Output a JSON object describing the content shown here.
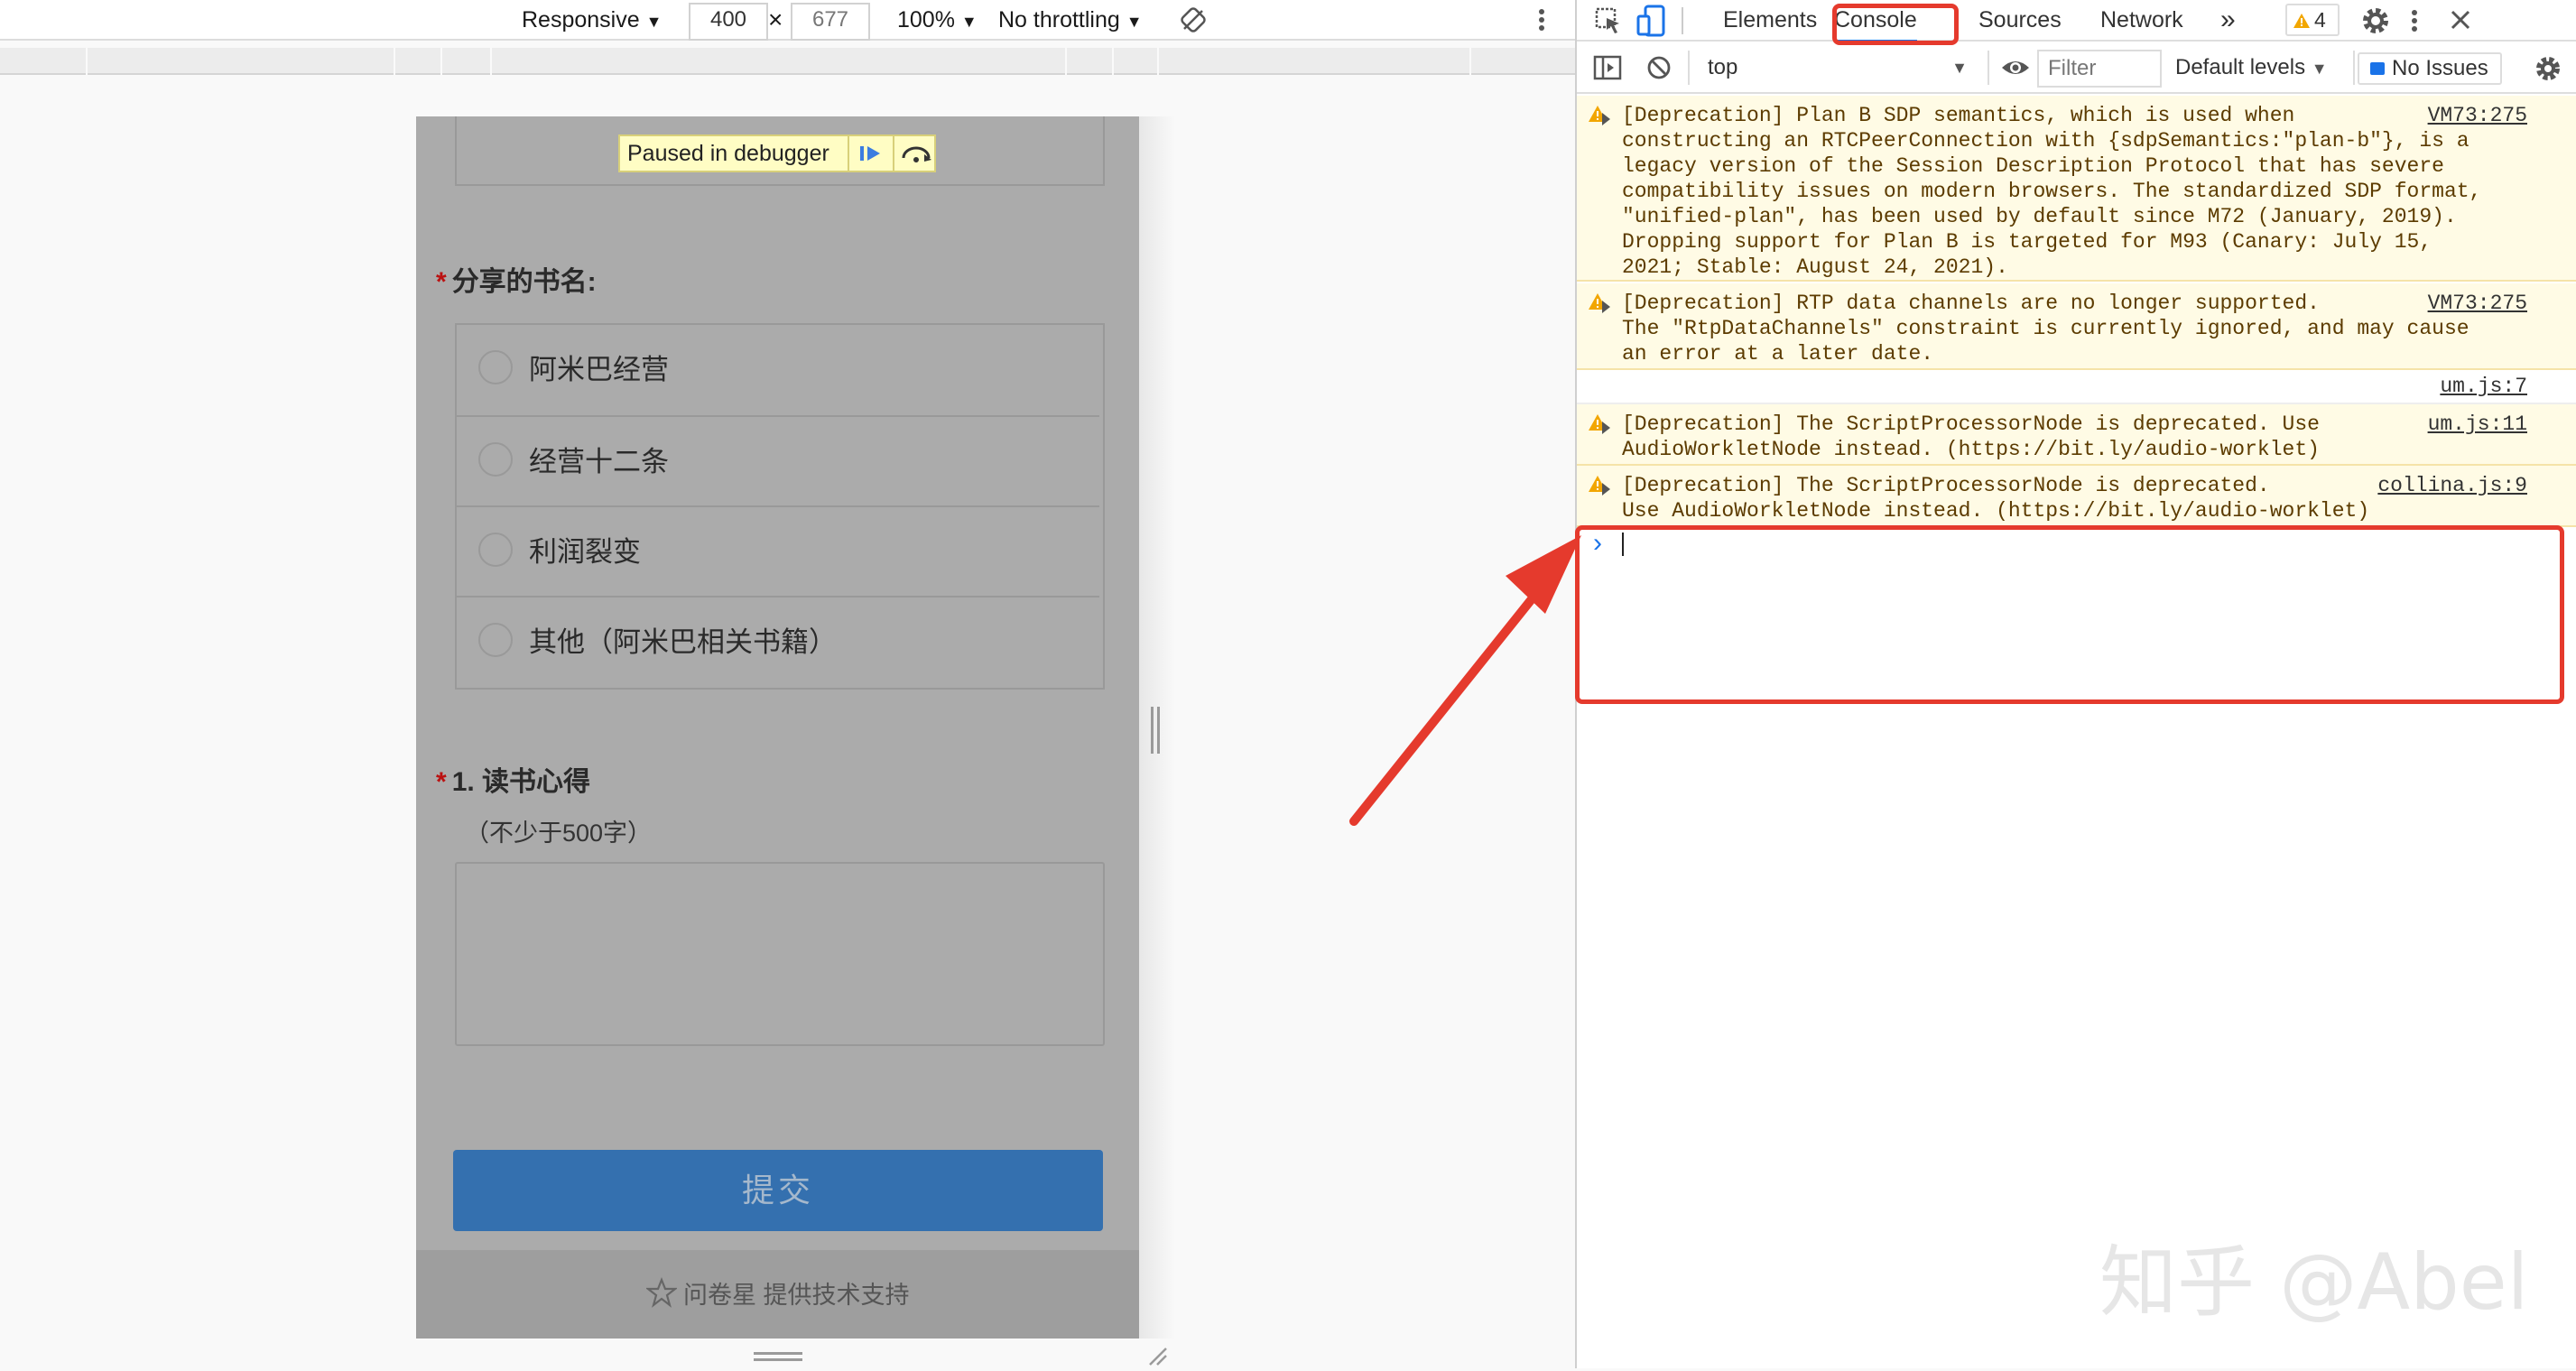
{
  "device_toolbar": {
    "device_mode": "Responsive",
    "width": "400",
    "times": "×",
    "height": "677",
    "zoom": "100%",
    "throttling": "No throttling"
  },
  "page": {
    "paused_label": "Paused in debugger",
    "q1": {
      "required_mark": "*",
      "title": "分享的书名:",
      "options": [
        "阿米巴经营",
        "经营十二条",
        "利润裂变",
        "其他（阿米巴相关书籍）"
      ]
    },
    "q2": {
      "required_mark": "*",
      "title": "1. 读书心得",
      "hint": "（不少于500字）"
    },
    "submit_label": "提交",
    "footer_text": "问卷星 提供技术支持"
  },
  "devtools": {
    "tabs": [
      "Elements",
      "Console",
      "Sources",
      "Network"
    ],
    "active_tab": "Console",
    "more_tabs": "»",
    "warning_count": "4",
    "console_toolbar": {
      "context": "top",
      "filter_placeholder": "Filter",
      "levels": "Default levels",
      "issues": "No Issues"
    },
    "messages": [
      {
        "text": "[Deprecation] Plan B SDP semantics, which is used when\nconstructing an RTCPeerConnection with {sdpSemantics:\"plan-b\"}, is a\nlegacy version of the Session Description Protocol that has severe\ncompatibility issues on modern browsers. The standardized SDP format,\n\"unified-plan\", has been used by default since M72 (January, 2019).\nDropping support for Plan B is targeted for M93 (Canary: July 15,\n2021; Stable: August 24, 2021).",
        "source": "VM73:275"
      },
      {
        "text": "[Deprecation] RTP data channels are no longer supported.\nThe \"RtpDataChannels\" constraint is currently ignored, and may cause\nan error at a later date.",
        "source": "VM73:275"
      },
      {
        "text": "",
        "source": "um.js:7"
      },
      {
        "text": "[Deprecation] The ScriptProcessorNode is deprecated. Use\nAudioWorkletNode instead. (https://bit.ly/audio-worklet)",
        "source": "um.js:11"
      },
      {
        "text": "[Deprecation] The ScriptProcessorNode is deprecated.\nUse AudioWorkletNode instead. (https://bit.ly/audio-worklet)",
        "source": "collina.js:9"
      }
    ],
    "prompt": "›"
  },
  "watermark": "知乎 @Abel",
  "colors": {
    "annotation_red": "#e53a2d",
    "submit_blue": "#3470af",
    "warning_bg": "#fffbe5"
  }
}
